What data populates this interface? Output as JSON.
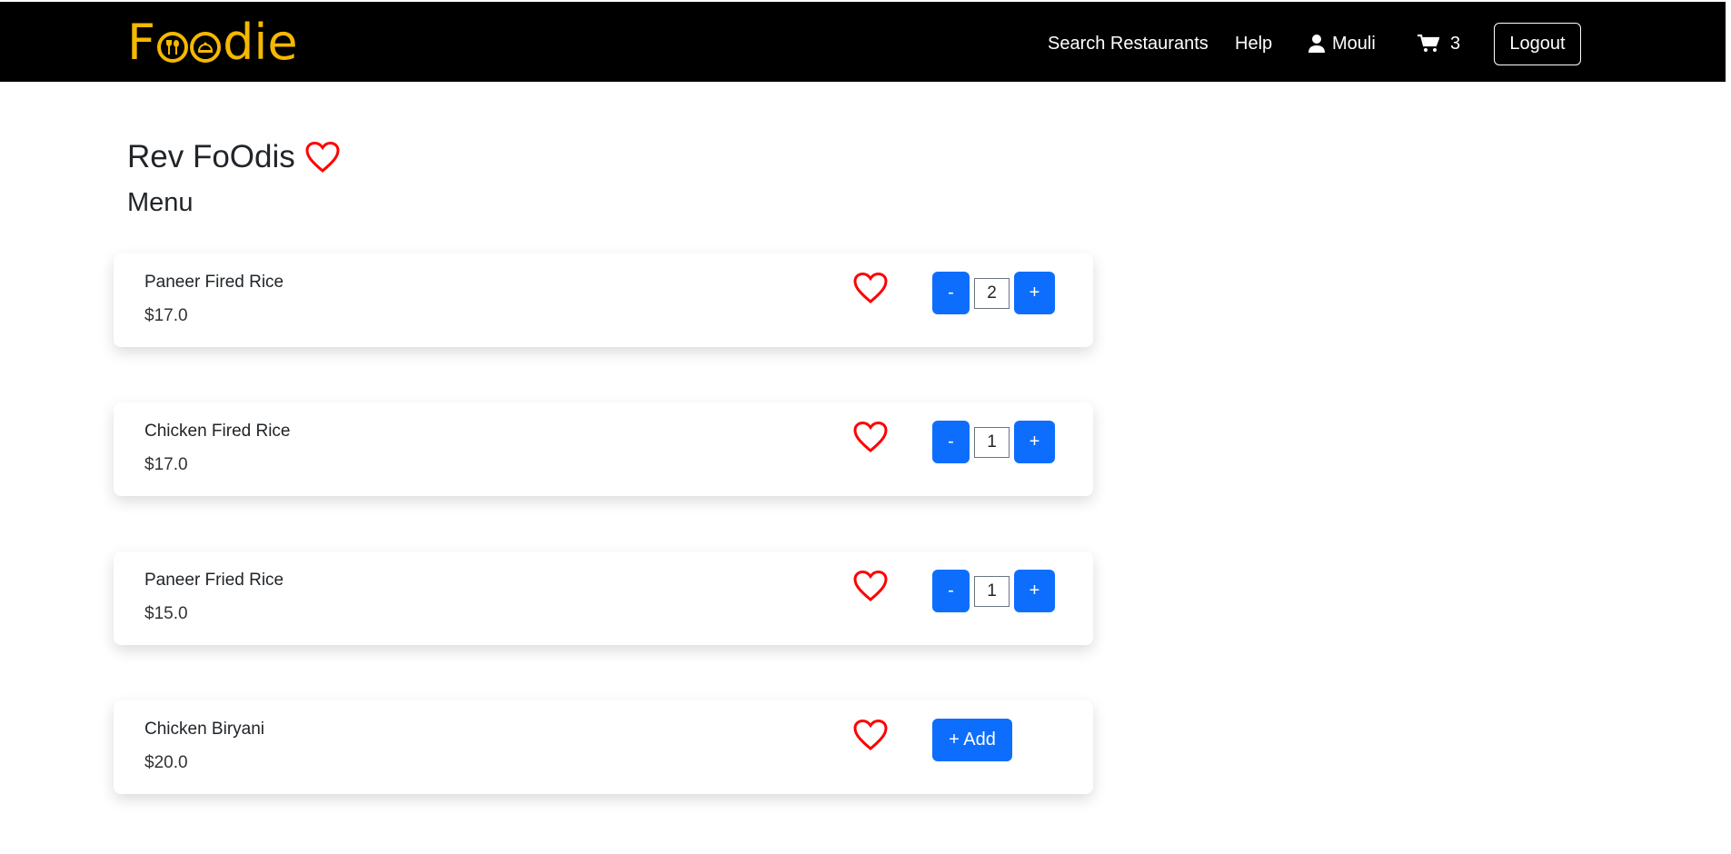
{
  "brand": {
    "logo_first": "F",
    "logo_rest": "die",
    "logo_color": "#f5b800"
  },
  "nav": {
    "search_label": "Search Restaurants",
    "help_label": "Help",
    "user_name": "Mouli",
    "cart_count": "3",
    "logout_label": "Logout"
  },
  "restaurant": {
    "name": "Rev FoOdis"
  },
  "menu": {
    "heading": "Menu",
    "items": [
      {
        "name": "Paneer Fired Rice",
        "price": "$17.0",
        "quantity": "2",
        "minus": "-",
        "plus": "+"
      },
      {
        "name": "Chicken Fired Rice",
        "price": "$17.0",
        "quantity": "1",
        "minus": "-",
        "plus": "+"
      },
      {
        "name": "Paneer Fried Rice",
        "price": "$15.0",
        "quantity": "1",
        "minus": "-",
        "plus": "+"
      },
      {
        "name": "Chicken Biryani",
        "price": "$20.0",
        "add_label": "+ Add"
      }
    ]
  },
  "colors": {
    "primary": "#0d6efd",
    "heart": "#ff0000",
    "navbar": "#000000"
  },
  "icons": {
    "user": "user-icon",
    "cart": "cart-icon",
    "favorite": "heart-outline-icon"
  }
}
